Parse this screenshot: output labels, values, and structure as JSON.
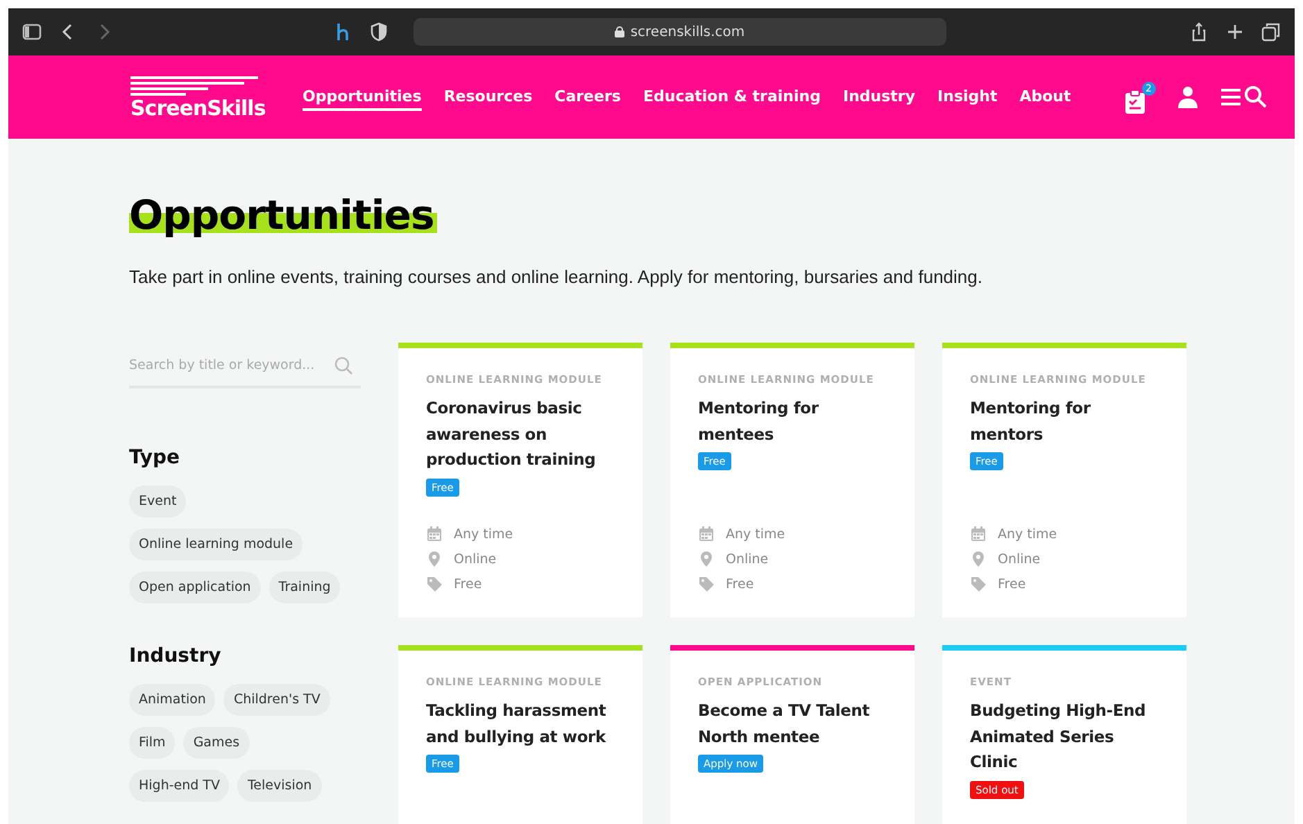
{
  "browser": {
    "url": "screenskills.com"
  },
  "header": {
    "logo": "ScreenSkills",
    "nav": [
      {
        "label": "Opportunities",
        "selected": true
      },
      {
        "label": "Resources",
        "selected": false
      },
      {
        "label": "Careers",
        "selected": false
      },
      {
        "label": "Education & training",
        "selected": false
      },
      {
        "label": "Industry",
        "selected": false
      },
      {
        "label": "Insight",
        "selected": false
      },
      {
        "label": "About",
        "selected": false
      }
    ],
    "basket_count": "2"
  },
  "page": {
    "title": "Opportunities",
    "intro": "Take part in online events, training courses and online learning. Apply for mentoring, bursaries and funding."
  },
  "search": {
    "placeholder": "Search by title or keyword..."
  },
  "filters": [
    {
      "heading": "Type",
      "options": [
        [
          "Event"
        ],
        [
          "Online learning module"
        ],
        [
          "Open application",
          "Training"
        ]
      ]
    },
    {
      "heading": "Industry",
      "options": [
        [
          "Animation",
          "Children's TV"
        ],
        [
          "Film",
          "Games"
        ],
        [
          "High-end TV",
          "Television"
        ]
      ]
    }
  ],
  "cards": [
    {
      "category": "ONLINE LEARNING MODULE",
      "title": "Coronavirus basic awareness on production training",
      "badge": {
        "label": "Free",
        "kind": "info"
      },
      "color": "#a6e11b",
      "details": [
        {
          "kind": "date",
          "text": "Any time"
        },
        {
          "kind": "location",
          "text": "Online"
        },
        {
          "kind": "price",
          "text": "Free"
        }
      ]
    },
    {
      "category": "ONLINE LEARNING MODULE",
      "title": "Mentoring for mentees",
      "badge": {
        "label": "Free",
        "kind": "info"
      },
      "color": "#a6e11b",
      "details": [
        {
          "kind": "date",
          "text": "Any time"
        },
        {
          "kind": "location",
          "text": "Online"
        },
        {
          "kind": "price",
          "text": "Free"
        }
      ]
    },
    {
      "category": "ONLINE LEARNING MODULE",
      "title": "Mentoring for mentors",
      "badge": {
        "label": "Free",
        "kind": "info"
      },
      "color": "#a6e11b",
      "details": [
        {
          "kind": "date",
          "text": "Any time"
        },
        {
          "kind": "location",
          "text": "Online"
        },
        {
          "kind": "price",
          "text": "Free"
        }
      ]
    },
    {
      "category": "ONLINE LEARNING MODULE",
      "title": "Tackling harassment and bullying at work",
      "badge": {
        "label": "Free",
        "kind": "info"
      },
      "color": "#a6e11b"
    },
    {
      "category": "OPEN APPLICATION",
      "title": "Become a TV Talent North mentee",
      "badge": {
        "label": "Apply now",
        "kind": "info"
      },
      "color": "#ff0a8c"
    },
    {
      "category": "EVENT",
      "title": "Budgeting High-End Animated Series Clinic",
      "badge": {
        "label": "Sold out",
        "kind": "alert"
      },
      "color": "#1ccdf2"
    }
  ]
}
